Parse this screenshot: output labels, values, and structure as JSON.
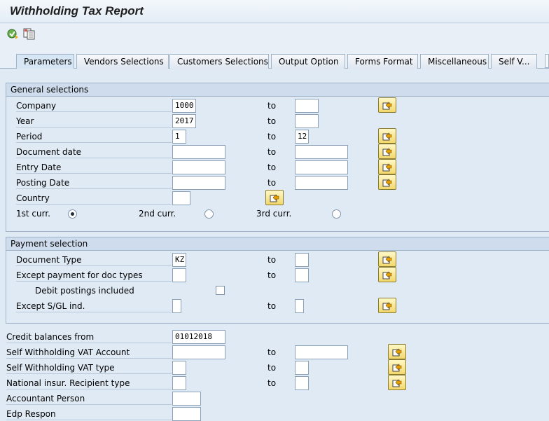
{
  "window": {
    "title": "Withholding Tax Report"
  },
  "toolbar": {
    "icons": [
      "execute-icon",
      "variant-icon"
    ]
  },
  "tabs": [
    {
      "label": "Parameters",
      "active": true
    },
    {
      "label": "Vendors Selections"
    },
    {
      "label": "Customers Selections"
    },
    {
      "label": "Output Option"
    },
    {
      "label": "Forms Format"
    },
    {
      "label": "Miscellaneous"
    },
    {
      "label": "Self V..."
    }
  ],
  "general": {
    "header": "General selections",
    "company": {
      "label": "Company",
      "from": "1000",
      "to": ""
    },
    "year": {
      "label": "Year",
      "from": "2017",
      "to": ""
    },
    "period": {
      "label": "Period",
      "from": "1",
      "to": "12"
    },
    "docdate": {
      "label": "Document date",
      "from": "",
      "to": ""
    },
    "entrydate": {
      "label": "Entry Date",
      "from": "",
      "to": ""
    },
    "postdate": {
      "label": "Posting Date",
      "from": "",
      "to": ""
    },
    "country": {
      "label": "Country",
      "from": ""
    },
    "curr1": "1st curr.",
    "curr2": "2nd curr.",
    "curr3": "3rd curr.",
    "to_label": "to"
  },
  "payment": {
    "header": "Payment selection",
    "doctype": {
      "label": "Document Type",
      "from": "KZ",
      "to": ""
    },
    "except": {
      "label": "Except payment for doc types",
      "from": "",
      "to": ""
    },
    "debit": {
      "label": "Debit postings included",
      "checked": false
    },
    "sgl": {
      "label": "Except S/GL ind.",
      "from": "",
      "to": ""
    }
  },
  "bottom": {
    "credit": {
      "label": "Credit balances from",
      "value": "01012018"
    },
    "vat_account": {
      "label": "Self Withholding VAT Account",
      "from": "",
      "to": ""
    },
    "vat_type": {
      "label": "Self Withholding VAT type",
      "from": "",
      "to": ""
    },
    "national": {
      "label": "National insur. Recipient type",
      "from": "",
      "to": ""
    },
    "accountant": {
      "label": "Accountant Person",
      "value": ""
    },
    "edp": {
      "label": "Edp Respon",
      "value": ""
    }
  }
}
